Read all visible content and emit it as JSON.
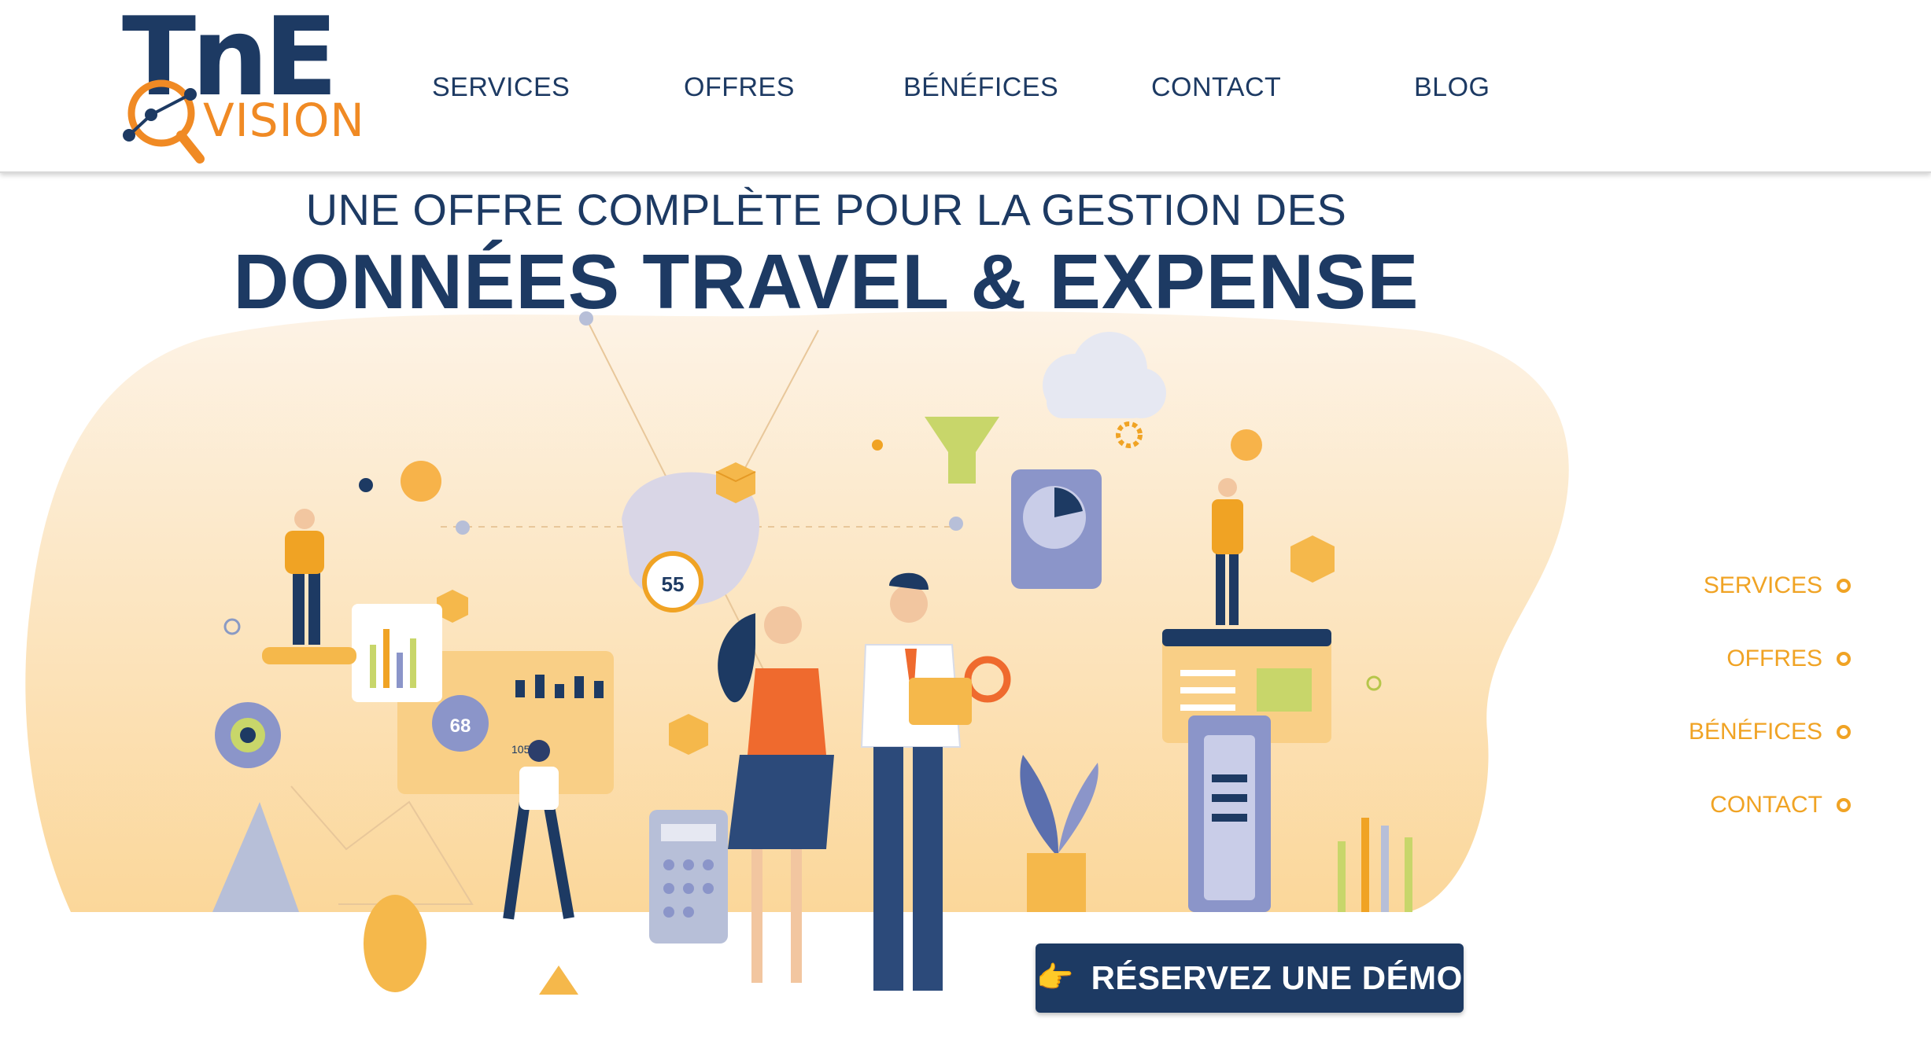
{
  "logo": {
    "line1": "TnE",
    "line2": "VISION"
  },
  "nav": [
    "SERVICES",
    "OFFRES",
    "BÉNÉFICES",
    "CONTACT",
    "BLOG"
  ],
  "hero": {
    "line1": "UNE OFFRE COMPLÈTE POUR LA GESTION DES",
    "line2": "DONNÉES TRAVEL & EXPENSE"
  },
  "side_nav": [
    "SERVICES",
    "OFFRES",
    "BÉNÉFICES",
    "CONTACT"
  ],
  "illustration": {
    "badge_a": "55",
    "badge_b": "68",
    "badge_c": "105"
  },
  "cta": {
    "icon": "👉",
    "label": "RÉSERVEZ UNE DÉMO"
  },
  "colors": {
    "navy": "#1d3a63",
    "orange": "#f08a24",
    "gold": "#f0a324"
  }
}
